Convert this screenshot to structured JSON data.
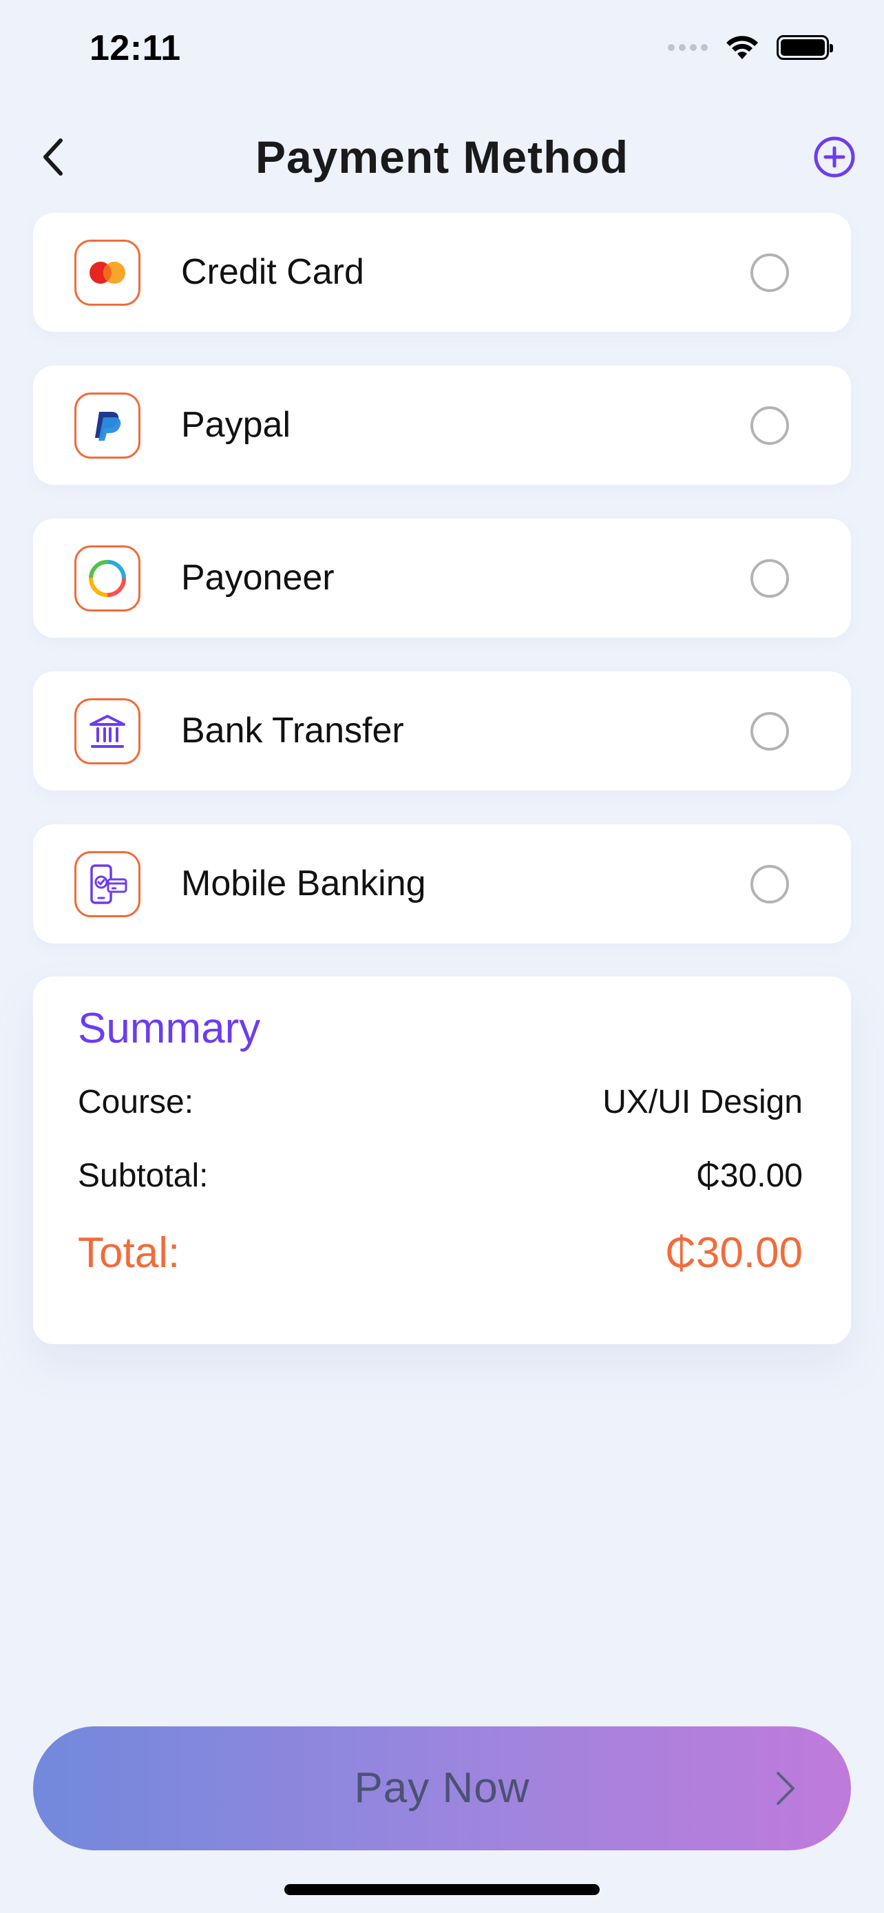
{
  "status_bar": {
    "time": "12:11"
  },
  "header": {
    "title": "Payment Method"
  },
  "methods": [
    {
      "label": "Credit Card",
      "icon": "credit-card-icon"
    },
    {
      "label": "Paypal",
      "icon": "paypal-icon"
    },
    {
      "label": "Payoneer",
      "icon": "payoneer-icon"
    },
    {
      "label": "Bank Transfer",
      "icon": "bank-icon"
    },
    {
      "label": "Mobile Banking",
      "icon": "mobile-banking-icon"
    }
  ],
  "summary": {
    "title": "Summary",
    "course_label": "Course:",
    "course_value": "UX/UI Design",
    "subtotal_label": "Subtotal:",
    "subtotal_value": "₵30.00",
    "total_label": "Total:",
    "total_value": "₵30.00"
  },
  "pay_button": {
    "label": "Pay Now"
  },
  "colors": {
    "accent": "#6c3cf0",
    "highlight": "#f26b3a",
    "background": "#eef2fb"
  }
}
